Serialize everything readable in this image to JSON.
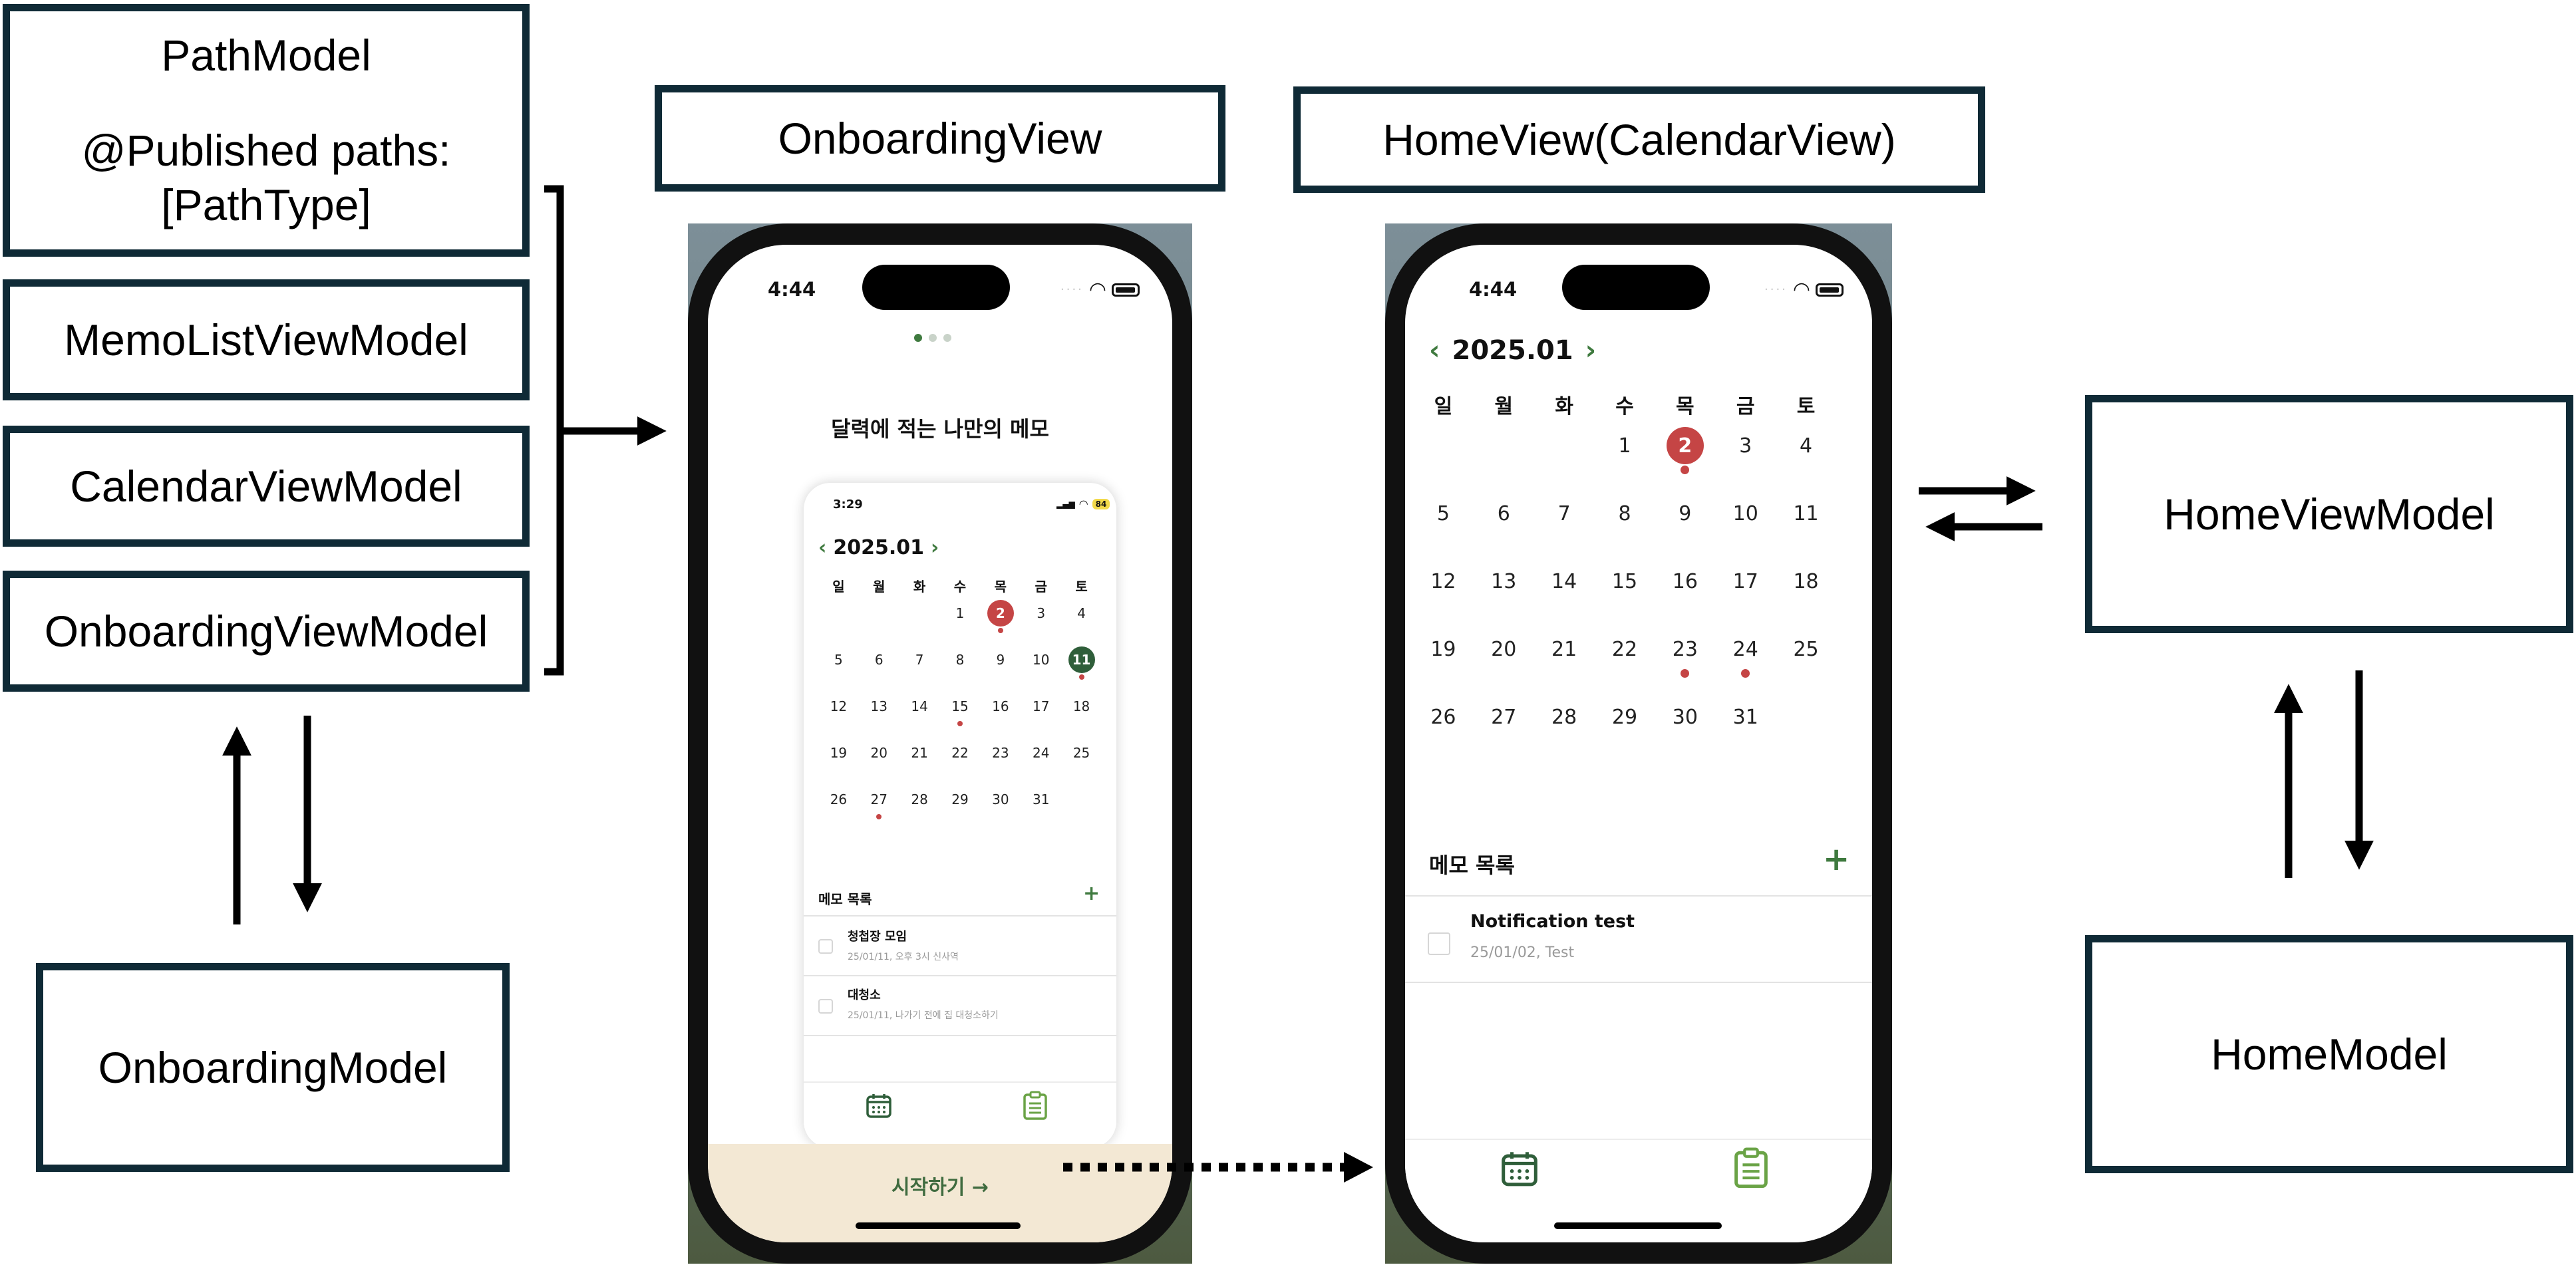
{
  "boxes": {
    "path_model": {
      "title": "PathModel",
      "line2": "@Published paths:",
      "line3": "[PathType]"
    },
    "memo_list_vm": "MemoListViewModel",
    "calendar_vm": "CalendarViewModel",
    "onboarding_vm": "OnboardingViewModel",
    "onboarding_model": "OnboardingModel",
    "onboarding_view": "OnboardingView",
    "home_view": "HomeView(CalendarView)",
    "home_vm": "HomeViewModel",
    "home_model": "HomeModel"
  },
  "onboarding": {
    "time": "4:44",
    "headline": "달력에 적는 나만의 메모",
    "start_label": "시작하기 →",
    "inner": {
      "time": "3:29",
      "battery": "84",
      "month": "2025.01",
      "weekdays": [
        "일",
        "월",
        "화",
        "수",
        "목",
        "금",
        "토"
      ],
      "weeks": [
        [
          "",
          "",
          "",
          "1",
          "2",
          "3",
          "4"
        ],
        [
          "5",
          "6",
          "7",
          "8",
          "9",
          "10",
          "11"
        ],
        [
          "12",
          "13",
          "14",
          "15",
          "16",
          "17",
          "18"
        ],
        [
          "19",
          "20",
          "21",
          "22",
          "23",
          "24",
          "25"
        ],
        [
          "26",
          "27",
          "28",
          "29",
          "30",
          "31",
          ""
        ]
      ],
      "memo_header": "메모 목록",
      "memos": [
        {
          "title": "청첩장 모임",
          "subtitle": "25/01/11, 오후 3시 신사역"
        },
        {
          "title": "대청소",
          "subtitle": "25/01/11, 나가기 전에 집 대청소하기"
        }
      ]
    }
  },
  "home": {
    "time": "4:44",
    "month": "2025.01",
    "weekdays": [
      "일",
      "월",
      "화",
      "수",
      "목",
      "금",
      "토"
    ],
    "weeks": [
      [
        "",
        "",
        "",
        "1",
        "2",
        "3",
        "4"
      ],
      [
        "5",
        "6",
        "7",
        "8",
        "9",
        "10",
        "11"
      ],
      [
        "12",
        "13",
        "14",
        "15",
        "16",
        "17",
        "18"
      ],
      [
        "19",
        "20",
        "21",
        "22",
        "23",
        "24",
        "25"
      ],
      [
        "26",
        "27",
        "28",
        "29",
        "30",
        "31",
        ""
      ]
    ],
    "memo_header": "메모 목록",
    "memos": [
      {
        "title": "Notification test",
        "subtitle": "25/01/02, Test"
      }
    ]
  },
  "colors": {
    "box_border": "#0f2a36",
    "accent_green": "#3f7a3f",
    "accent_red": "#c54545",
    "start_bar": "#f3e8d4"
  },
  "icons": [
    "calendar-icon",
    "memo-list-icon",
    "wifi-icon",
    "battery-icon",
    "chevron-left-icon",
    "chevron-right-icon",
    "plus-icon"
  ]
}
